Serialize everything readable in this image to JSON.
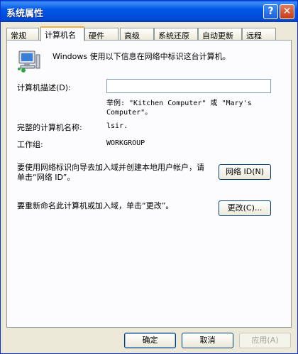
{
  "window": {
    "title": "系统属性",
    "help_label": "?",
    "close_label": "✕"
  },
  "tabs": [
    {
      "label": "常规"
    },
    {
      "label": "计算机名"
    },
    {
      "label": "硬件"
    },
    {
      "label": "高级"
    },
    {
      "label": "系统还原"
    },
    {
      "label": "自动更新"
    },
    {
      "label": "远程"
    }
  ],
  "panel": {
    "intro": "Windows 使用以下信息在网络中标识这台计算机。",
    "desc_label": "计算机描述(D):",
    "desc_value": "",
    "example": "举例: \"Kitchen Computer\" 或 \"Mary's Computer\"。",
    "fullname_label": "完整的计算机名称:",
    "fullname_value": "lsir.",
    "workgroup_label": "工作组:",
    "workgroup_value": "WORKGROUP",
    "netid_text": "要使用网络标识向导去加入域并创建本地用户帐户，请单击“网络 ID”。",
    "netid_button": "网络 ID(N)",
    "rename_text": "要重新命名此计算机或加入域，单击“更改”。",
    "change_button": "更改(C)..."
  },
  "footer": {
    "ok": "确定",
    "cancel": "取消",
    "apply": "应用(A)"
  }
}
